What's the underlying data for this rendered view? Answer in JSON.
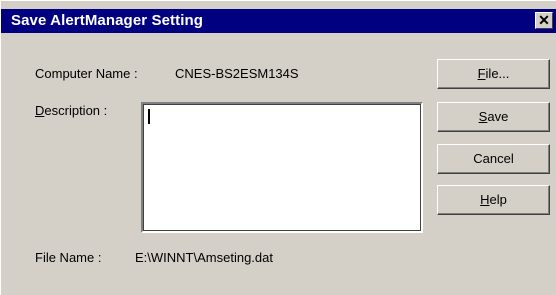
{
  "window": {
    "title": "Save AlertManager Setting",
    "close_glyph": "✕"
  },
  "form": {
    "computer_name_label": "Computer Name :",
    "computer_name_value": "CNES-BS2ESM134S",
    "description_label_mnemonic": "D",
    "description_label_rest": "escription :",
    "description_value": "",
    "file_name_label": "File Name :",
    "file_name_value": "E:\\WINNT\\Amseting.dat"
  },
  "buttons": {
    "file": {
      "mnemonic": "F",
      "rest": "ile..."
    },
    "save": {
      "mnemonic": "S",
      "rest": "ave"
    },
    "cancel": {
      "label": "Cancel"
    },
    "help": {
      "mnemonic": "H",
      "rest": "elp"
    }
  },
  "colors": {
    "titlebar": "#000080",
    "dialog_face": "#d4d0c8"
  }
}
